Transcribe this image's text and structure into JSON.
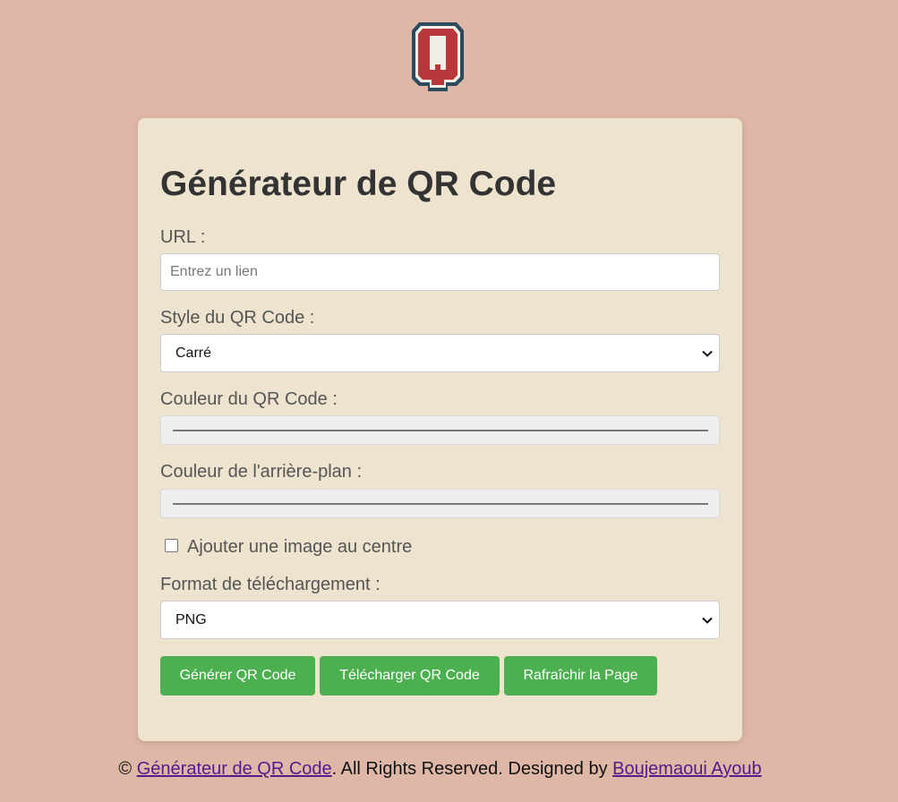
{
  "form": {
    "title": "Générateur de QR Code",
    "url_label": "URL :",
    "url_placeholder": "Entrez un lien",
    "url_value": "",
    "style_label": "Style du QR Code :",
    "style_value": "Carré",
    "color_label": "Couleur du QR Code :",
    "bg_color_label": "Couleur de l'arrière-plan :",
    "image_checkbox_label": "Ajouter une image au centre",
    "image_checkbox_checked": false,
    "format_label": "Format de téléchargement :",
    "format_value": "PNG",
    "buttons": {
      "generate": "Générer QR Code",
      "download": "Télécharger QR Code",
      "refresh": "Rafraîchir la Page"
    }
  },
  "logo": {
    "letter": "Q",
    "colors": {
      "outer": "#2c4a5e",
      "inner": "#b8373a",
      "fill": "#f4efe6"
    }
  },
  "footer": {
    "copyright_symbol": "©",
    "site_link": "Générateur de QR Code",
    "rights_text": ". All Rights Reserved. Designed by ",
    "author_link": "Boujemaoui Ayoub"
  },
  "colors": {
    "background": "#dfb7a6",
    "card": "#ede3cf",
    "button": "#4caf50",
    "link": "#551a8b"
  }
}
